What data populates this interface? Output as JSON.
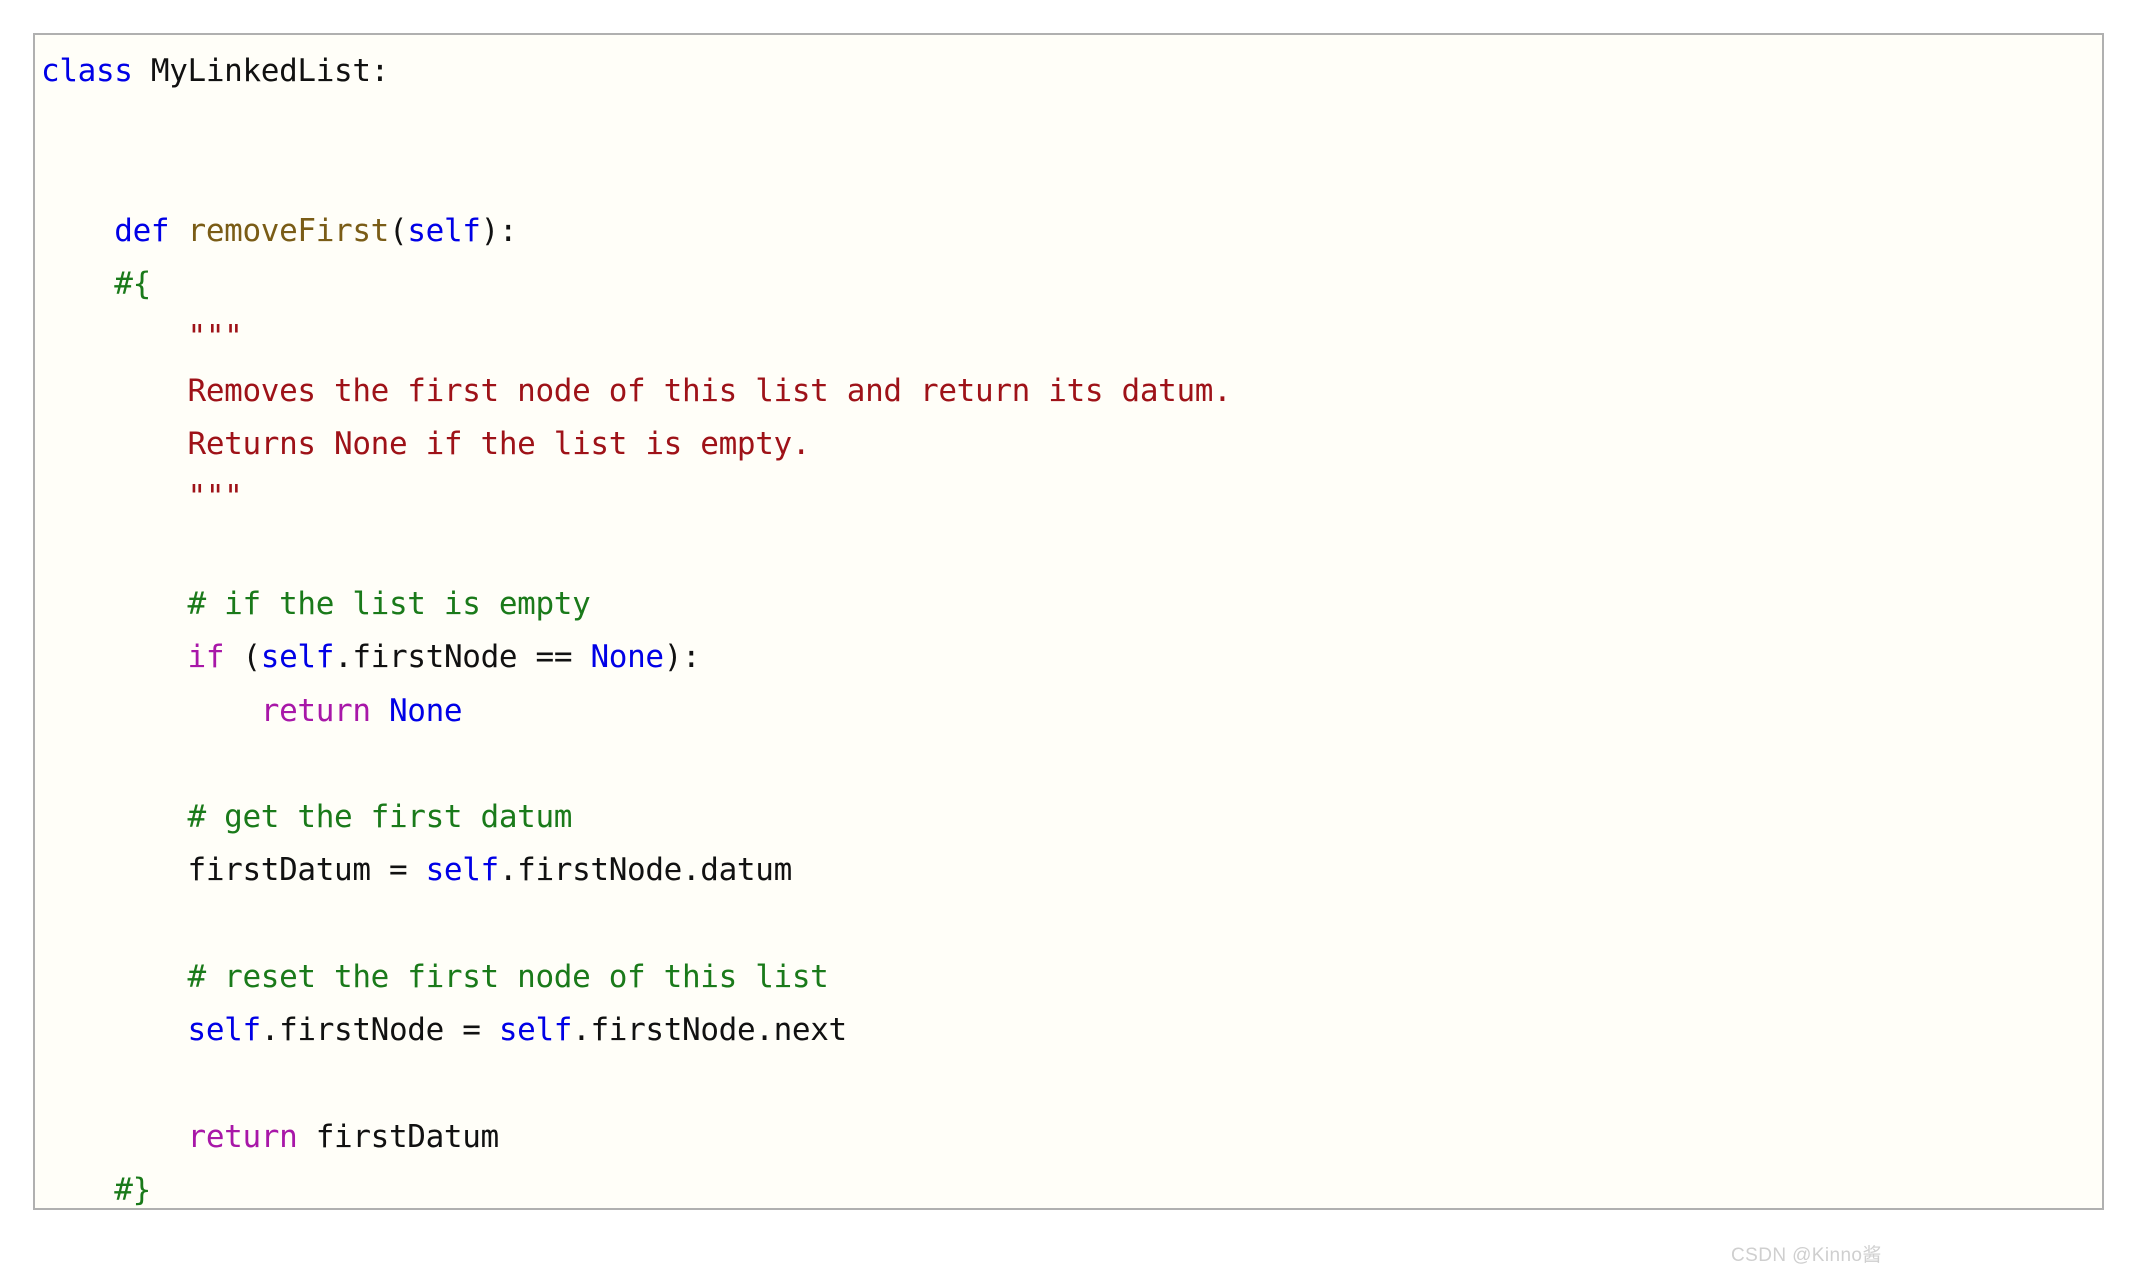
{
  "card": {
    "background_color": "#fffef8",
    "border_color": "#b0b0b0"
  },
  "colors": {
    "keyword_blue": "#0000e6",
    "keyword_magenta": "#a817a8",
    "function_name": "#7a5c16",
    "comment_green": "#1a7a1a",
    "docstring_red": "#9e1218",
    "plain_text": "#111111",
    "watermark": "#cfcfcf"
  },
  "code": {
    "language": "python",
    "class_name": "MyLinkedList",
    "method_name": "removeFirst",
    "lines": [
      {
        "n": 1,
        "tokens": [
          {
            "t": "class",
            "c": "kw-blue"
          },
          {
            "t": " MyLinkedList:",
            "c": "plain"
          }
        ]
      },
      {
        "n": 2,
        "tokens": []
      },
      {
        "n": 3,
        "tokens": []
      },
      {
        "n": 4,
        "tokens": [
          {
            "t": "    ",
            "c": "plain"
          },
          {
            "t": "def",
            "c": "kw-blue"
          },
          {
            "t": " ",
            "c": "plain"
          },
          {
            "t": "removeFirst",
            "c": "fname"
          },
          {
            "t": "(",
            "c": "plain"
          },
          {
            "t": "self",
            "c": "kw-blue"
          },
          {
            "t": "):",
            "c": "plain"
          }
        ]
      },
      {
        "n": 5,
        "tokens": [
          {
            "t": "    ",
            "c": "plain"
          },
          {
            "t": "#{",
            "c": "comment"
          }
        ]
      },
      {
        "n": 6,
        "tokens": [
          {
            "t": "        ",
            "c": "plain"
          },
          {
            "t": "\"\"\"",
            "c": "docstr"
          }
        ]
      },
      {
        "n": 7,
        "tokens": [
          {
            "t": "        ",
            "c": "plain"
          },
          {
            "t": "Removes the first node of this list and return its datum.",
            "c": "docstr"
          }
        ]
      },
      {
        "n": 8,
        "tokens": [
          {
            "t": "        ",
            "c": "plain"
          },
          {
            "t": "Returns None if the list is empty.",
            "c": "docstr"
          }
        ]
      },
      {
        "n": 9,
        "tokens": [
          {
            "t": "        ",
            "c": "plain"
          },
          {
            "t": "\"\"\"",
            "c": "docstr"
          }
        ]
      },
      {
        "n": 10,
        "tokens": []
      },
      {
        "n": 11,
        "tokens": [
          {
            "t": "        ",
            "c": "plain"
          },
          {
            "t": "# if the list is empty",
            "c": "comment"
          }
        ]
      },
      {
        "n": 12,
        "tokens": [
          {
            "t": "        ",
            "c": "plain"
          },
          {
            "t": "if",
            "c": "kw-magenta"
          },
          {
            "t": " (",
            "c": "plain"
          },
          {
            "t": "self",
            "c": "kw-blue"
          },
          {
            "t": ".firstNode == ",
            "c": "plain"
          },
          {
            "t": "None",
            "c": "kw-blue"
          },
          {
            "t": "):",
            "c": "plain"
          }
        ]
      },
      {
        "n": 13,
        "tokens": [
          {
            "t": "            ",
            "c": "plain"
          },
          {
            "t": "return",
            "c": "kw-magenta"
          },
          {
            "t": " ",
            "c": "plain"
          },
          {
            "t": "None",
            "c": "kw-blue"
          }
        ]
      },
      {
        "n": 14,
        "tokens": []
      },
      {
        "n": 15,
        "tokens": [
          {
            "t": "        ",
            "c": "plain"
          },
          {
            "t": "# get the first datum",
            "c": "comment"
          }
        ]
      },
      {
        "n": 16,
        "tokens": [
          {
            "t": "        firstDatum = ",
            "c": "plain"
          },
          {
            "t": "self",
            "c": "kw-blue"
          },
          {
            "t": ".firstNode.datum",
            "c": "plain"
          }
        ]
      },
      {
        "n": 17,
        "tokens": []
      },
      {
        "n": 18,
        "tokens": [
          {
            "t": "        ",
            "c": "plain"
          },
          {
            "t": "# reset the first node of this list",
            "c": "comment"
          }
        ]
      },
      {
        "n": 19,
        "tokens": [
          {
            "t": "        ",
            "c": "plain"
          },
          {
            "t": "self",
            "c": "kw-blue"
          },
          {
            "t": ".firstNode = ",
            "c": "plain"
          },
          {
            "t": "self",
            "c": "kw-blue"
          },
          {
            "t": ".firstNode.next",
            "c": "plain"
          }
        ]
      },
      {
        "n": 20,
        "tokens": []
      },
      {
        "n": 21,
        "tokens": [
          {
            "t": "        ",
            "c": "plain"
          },
          {
            "t": "return",
            "c": "kw-magenta"
          },
          {
            "t": " firstDatum",
            "c": "plain"
          }
        ]
      },
      {
        "n": 22,
        "tokens": [
          {
            "t": "    ",
            "c": "plain"
          },
          {
            "t": "#}",
            "c": "comment"
          }
        ]
      }
    ]
  },
  "watermark": {
    "text": "CSDN @Kinno酱"
  }
}
